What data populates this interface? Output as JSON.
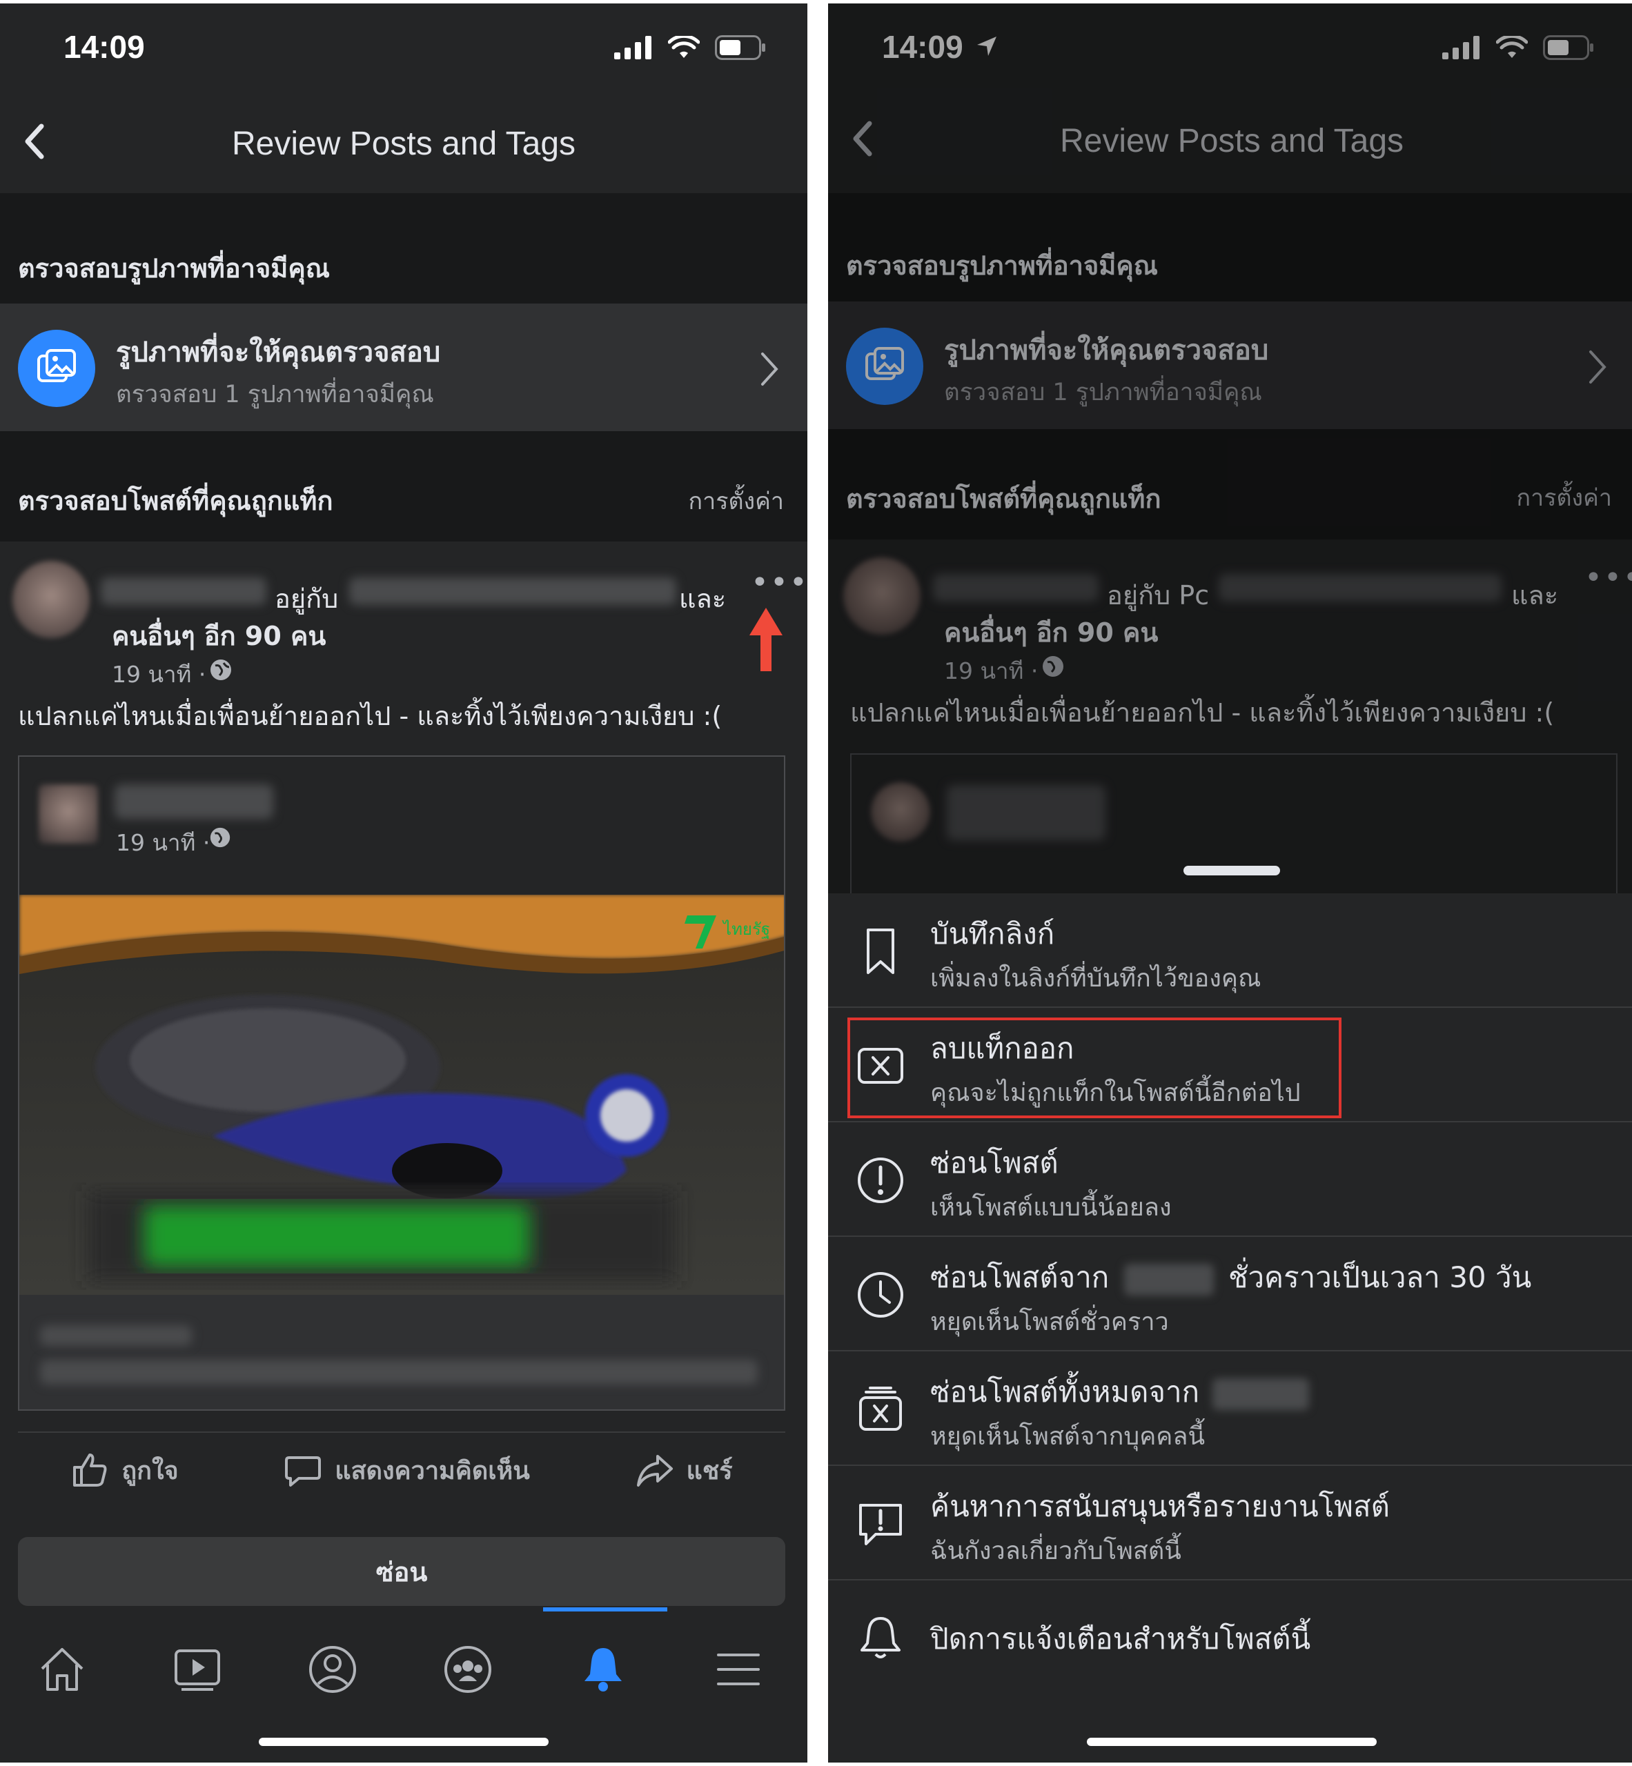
{
  "status": {
    "time_left": "14:09",
    "time_right": "14:09"
  },
  "nav": {
    "title": "Review Posts and Tags"
  },
  "photo_section": {
    "heading": "ตรวจสอบรูปภาพที่อาจมีคุณ",
    "row_title": "รูปภาพที่จะให้คุณตรวจสอบ",
    "row_subtitle": "ตรวจสอบ 1 รูปภาพที่อาจมีคุณ"
  },
  "tag_section": {
    "heading": "ตรวจสอบโพสต์ที่คุณถูกแท็ก",
    "settings_link": "การตั้งค่า"
  },
  "post": {
    "with_text": "อยู่กับ",
    "with_text_right": "อยู่กับ Pc",
    "and_text": "และ",
    "others_text": "คนอื่นๆ อีก 90 คน",
    "time": "19 นาที ·",
    "caption": "แปลกแค่ไหนเมื่อเพื่อนย้ายออกไป - และทิ้งไว้เพียงความเงียบ :(",
    "shared_time": "19 นาที ·",
    "more": "•••"
  },
  "actions": {
    "like": "ถูกใจ",
    "comment": "แสดงความคิดเห็น",
    "share": "แชร์",
    "hide_button": "ซ่อน"
  },
  "tabs": [
    "home",
    "watch",
    "profile",
    "groups",
    "notifications",
    "menu"
  ],
  "menu_sheet": {
    "items": [
      {
        "title": "บันทึกลิงก์",
        "subtitle": "เพิ่มลงในลิงก์ที่บันทึกไว้ของคุณ",
        "icon": "bookmark-icon"
      },
      {
        "title": "ลบแท็กออก",
        "subtitle": "คุณจะไม่ถูกแท็กในโพสต์นี้อีกต่อไป",
        "icon": "remove-tag-icon"
      },
      {
        "title": "ซ่อนโพสต์",
        "subtitle": "เห็นโพสต์แบบนี้น้อยลง",
        "icon": "alert-circle-icon"
      },
      {
        "title_prefix": "ซ่อนโพสต์จาก",
        "title_suffix": "ชั่วคราวเป็นเวลา 30 วัน",
        "subtitle": "หยุดเห็นโพสต์ชั่วคราว",
        "icon": "clock-icon"
      },
      {
        "title_prefix": "ซ่อนโพสต์ทั้งหมดจาก",
        "subtitle": "หยุดเห็นโพสต์จากบุคคลนี้",
        "icon": "unfollow-icon"
      },
      {
        "title": "ค้นหาการสนับสนุนหรือรายงานโพสต์",
        "subtitle": "ฉันกังวลเกี่ยวกับโพสต์นี้",
        "icon": "report-icon"
      },
      {
        "title": "ปิดการแจ้งเตือนสำหรับโพสต์นี้",
        "icon": "bell-off-icon"
      }
    ]
  },
  "colors": {
    "background": "#242526",
    "section": "#18191a",
    "accent": "#2d88ff",
    "highlight": "#e0342f",
    "arrow": "#f04a3a"
  }
}
